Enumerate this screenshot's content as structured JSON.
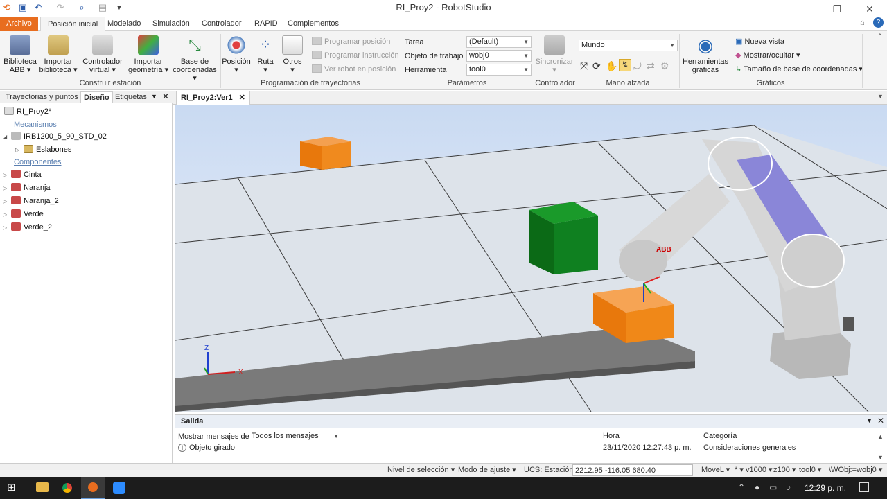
{
  "window": {
    "title": "RI_Proy2 - RobotStudio"
  },
  "ribbon_tabs": [
    "Archivo",
    "Posición inicial",
    "Modelado",
    "Simulación",
    "Controlador",
    "RAPID",
    "Complementos"
  ],
  "ribbon": {
    "construir": {
      "group_label": "Construir estación",
      "buttons": [
        {
          "line1": "Biblioteca",
          "line2": "ABB"
        },
        {
          "line1": "Importar",
          "line2": "biblioteca"
        },
        {
          "line1": "Controlador",
          "line2": "virtual"
        },
        {
          "line1": "Importar",
          "line2": "geometría"
        },
        {
          "line1": "Base de",
          "line2": "coordenadas"
        }
      ]
    },
    "programacion": {
      "group_label": "Programación de trayectorias",
      "buttons": [
        "Posición",
        "Ruta",
        "Otros"
      ],
      "small": [
        "Programar posición",
        "Programar instrucción",
        "Ver robot en posición"
      ]
    },
    "parametros": {
      "group_label": "Parámetros",
      "labels": [
        "Tarea",
        "Objeto de trabajo",
        "Herramienta"
      ],
      "values": [
        "(Default)",
        "wobj0",
        "tool0"
      ]
    },
    "controlador": {
      "group_label": "Controlador",
      "button": "Sincronizar"
    },
    "mano_alzada": {
      "group_label": "Mano alzada",
      "reference": "Mundo"
    },
    "graficos": {
      "group_label": "Gráficos",
      "button_line1": "Herramientas",
      "button_line2": "gráficas",
      "small": [
        "Nueva vista",
        "Mostrar/ocultar",
        "Tamaño de base de coordenadas"
      ]
    }
  },
  "left_panel": {
    "tabs": [
      "Trayectorias y puntos",
      "Diseño",
      "Etiquetas"
    ],
    "station": "RI_Proy2*",
    "mechanisms_label": "Mecanismos",
    "robot": "IRB1200_5_90_STD_02",
    "links": "Eslabones",
    "components_label": "Componentes",
    "components": [
      "Cinta",
      "Naranja",
      "Naranja_2",
      "Verde",
      "Verde_2"
    ]
  },
  "document_tab": "RI_Proy2:Ver1",
  "viewport": {
    "axis_labels": {
      "z": "Z",
      "x": "X"
    },
    "robot_logo": "ABB",
    "colors": {
      "orange": "#f07d0a",
      "green": "#0c7a18",
      "robot_accent": "#8a86d8"
    }
  },
  "output": {
    "title": "Salida",
    "filter_label": "Mostrar mensajes de:",
    "filter_value": "Todos los mensajes",
    "col_time": "Hora",
    "col_category": "Categoría",
    "message": "Objeto girado",
    "time": "23/11/2020 12:27:43 p. m.",
    "category": "Consideraciones generales"
  },
  "statusbar": {
    "selection_level": "Nivel de selección",
    "snap_mode": "Modo de ajuste",
    "ucs": "UCS: Estación",
    "coords": "2212.95  -116.05  680.40",
    "move": "MoveL",
    "star": "*",
    "speed": "v1000",
    "zone": "z100",
    "tool": "tool0",
    "wobj": "\\WObj:=wobj0"
  },
  "taskbar": {
    "time": "12:29 p. m."
  }
}
